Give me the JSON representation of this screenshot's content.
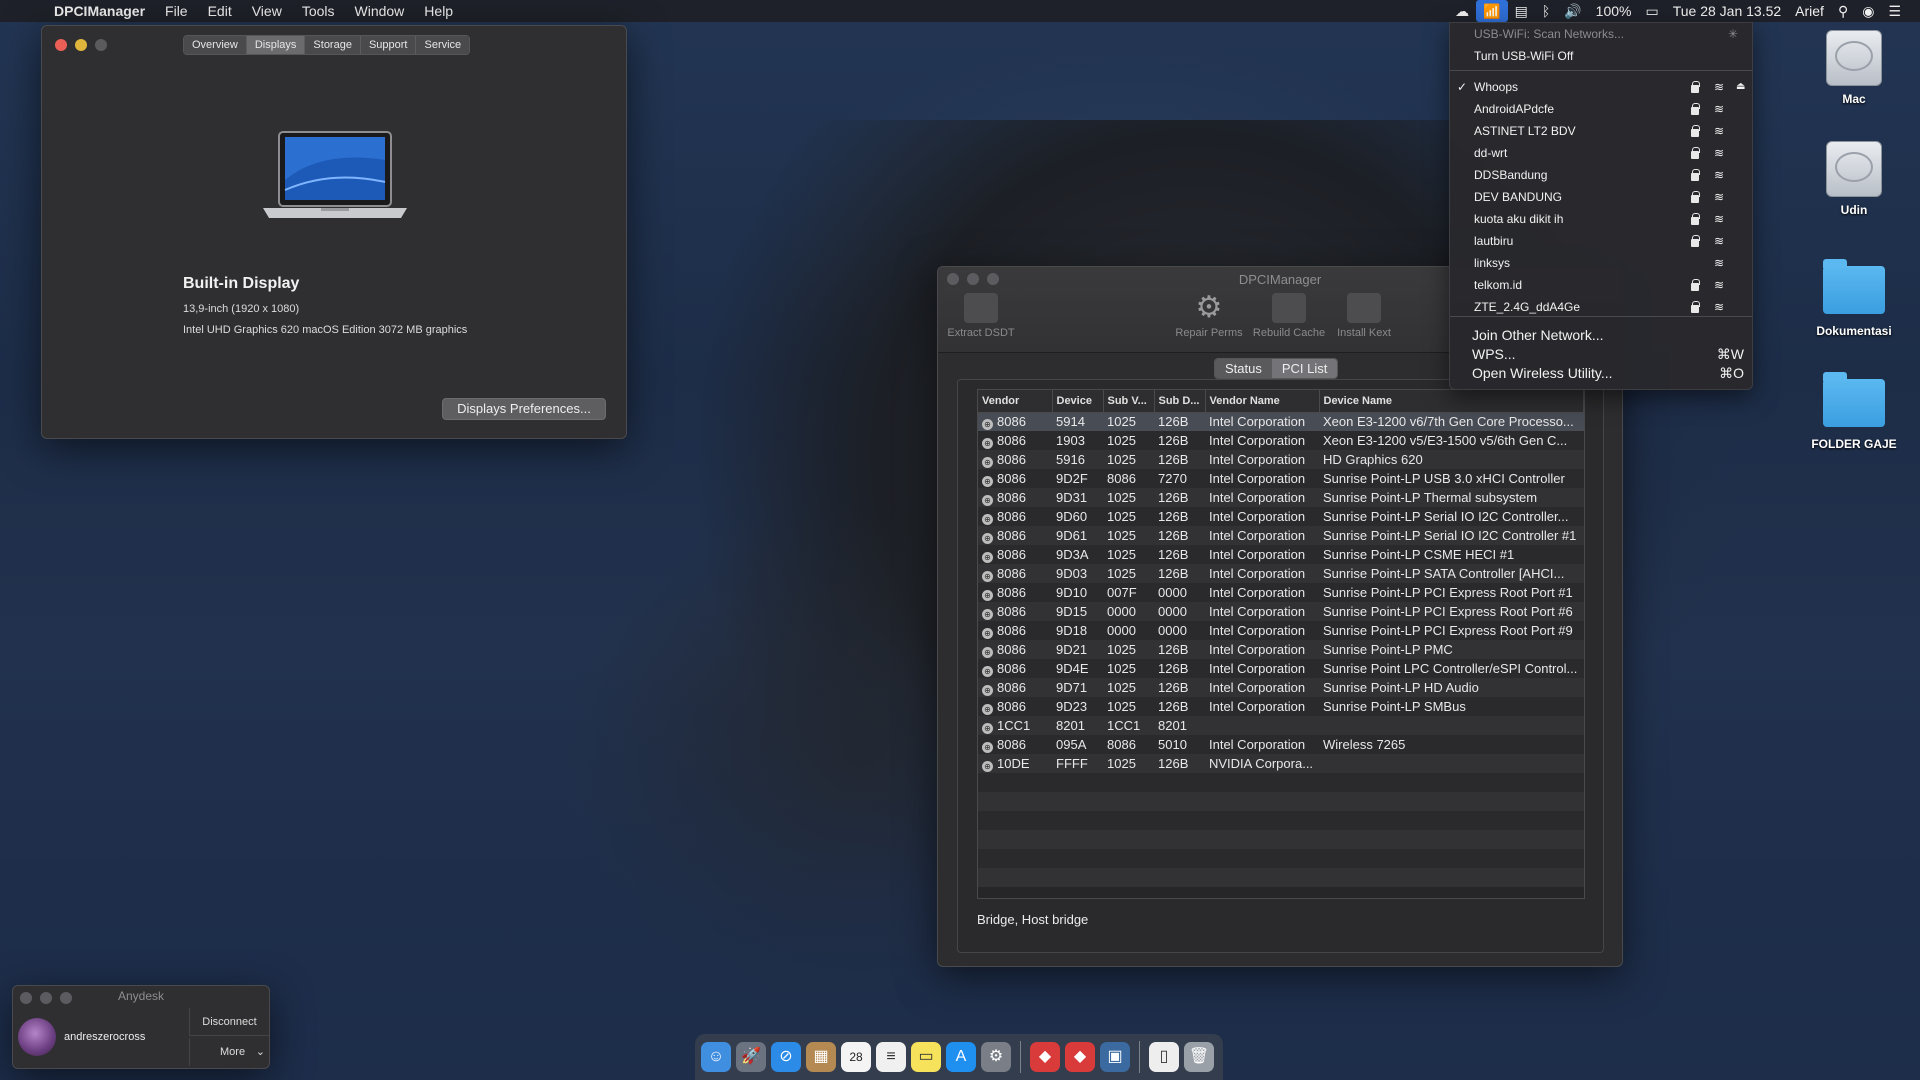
{
  "menubar": {
    "app_name": "DPCIManager",
    "menus": [
      "File",
      "Edit",
      "View",
      "Tools",
      "Window",
      "Help"
    ],
    "battery": "100%",
    "clock": "Tue 28 Jan  13.52",
    "user": "Arief"
  },
  "about_window": {
    "tabs": [
      "Overview",
      "Displays",
      "Storage",
      "Support",
      "Service"
    ],
    "selected_tab": "Displays",
    "title": "Built-in Display",
    "spec_size": "13,9-inch (1920 x 1080)",
    "spec_graphics": "Intel UHD Graphics 620 macOS Edition 3072 MB graphics",
    "prefs_button": "Displays Preferences..."
  },
  "dpci_window": {
    "title": "DPCIManager",
    "toolbar": {
      "extract": "Extract DSDT",
      "repair": "Repair Perms",
      "rebuild": "Rebuild Cache",
      "install": "Install Kext"
    },
    "segments": [
      "Status",
      "PCI List"
    ],
    "selected_segment": "PCI List",
    "columns": [
      "Vendor",
      "Device",
      "Sub V...",
      "Sub D...",
      "Vendor Name",
      "Device Name"
    ],
    "rows": [
      [
        "8086",
        "5914",
        "1025",
        "126B",
        "Intel Corporation",
        "Xeon E3-1200 v6/7th Gen Core Processo..."
      ],
      [
        "8086",
        "1903",
        "1025",
        "126B",
        "Intel Corporation",
        "Xeon E3-1200 v5/E3-1500 v5/6th Gen C..."
      ],
      [
        "8086",
        "5916",
        "1025",
        "126B",
        "Intel Corporation",
        "HD Graphics 620"
      ],
      [
        "8086",
        "9D2F",
        "8086",
        "7270",
        "Intel Corporation",
        "Sunrise Point-LP USB 3.0 xHCI Controller"
      ],
      [
        "8086",
        "9D31",
        "1025",
        "126B",
        "Intel Corporation",
        "Sunrise Point-LP Thermal subsystem"
      ],
      [
        "8086",
        "9D60",
        "1025",
        "126B",
        "Intel Corporation",
        "Sunrise Point-LP Serial IO I2C Controller..."
      ],
      [
        "8086",
        "9D61",
        "1025",
        "126B",
        "Intel Corporation",
        "Sunrise Point-LP Serial IO I2C Controller #1"
      ],
      [
        "8086",
        "9D3A",
        "1025",
        "126B",
        "Intel Corporation",
        "Sunrise Point-LP CSME HECI #1"
      ],
      [
        "8086",
        "9D03",
        "1025",
        "126B",
        "Intel Corporation",
        "Sunrise Point-LP SATA Controller [AHCI..."
      ],
      [
        "8086",
        "9D10",
        "007F",
        "0000",
        "Intel Corporation",
        "Sunrise Point-LP PCI Express Root Port #1"
      ],
      [
        "8086",
        "9D15",
        "0000",
        "0000",
        "Intel Corporation",
        "Sunrise Point-LP PCI Express Root Port #6"
      ],
      [
        "8086",
        "9D18",
        "0000",
        "0000",
        "Intel Corporation",
        "Sunrise Point-LP PCI Express Root Port #9"
      ],
      [
        "8086",
        "9D21",
        "1025",
        "126B",
        "Intel Corporation",
        "Sunrise Point-LP PMC"
      ],
      [
        "8086",
        "9D4E",
        "1025",
        "126B",
        "Intel Corporation",
        "Sunrise Point LPC Controller/eSPI Control..."
      ],
      [
        "8086",
        "9D71",
        "1025",
        "126B",
        "Intel Corporation",
        "Sunrise Point-LP HD Audio"
      ],
      [
        "8086",
        "9D23",
        "1025",
        "126B",
        "Intel Corporation",
        "Sunrise Point-LP SMBus"
      ],
      [
        "1CC1",
        "8201",
        "1CC1",
        "8201",
        "",
        ""
      ],
      [
        "8086",
        "095A",
        "8086",
        "5010",
        "Intel Corporation",
        "Wireless 7265"
      ],
      [
        "10DE",
        "FFFF",
        "1025",
        "126B",
        "NVIDIA Corpora...",
        ""
      ]
    ],
    "status_text": "Bridge, Host bridge"
  },
  "wifi_menu": {
    "scan": "USB-WiFi: Scan Networks...",
    "turn_off": "Turn USB-WiFi Off",
    "networks": [
      {
        "name": "Whoops",
        "checked": true,
        "locked": true
      },
      {
        "name": "AndroidAPdcfe",
        "checked": false,
        "locked": true
      },
      {
        "name": "ASTINET LT2 BDV",
        "checked": false,
        "locked": true
      },
      {
        "name": "dd-wrt",
        "checked": false,
        "locked": true
      },
      {
        "name": "DDSBandung",
        "checked": false,
        "locked": true
      },
      {
        "name": "DEV BANDUNG",
        "checked": false,
        "locked": true
      },
      {
        "name": "kuota aku dikit ih",
        "checked": false,
        "locked": true
      },
      {
        "name": "lautbiru",
        "checked": false,
        "locked": true
      },
      {
        "name": "linksys",
        "checked": false,
        "locked": false
      },
      {
        "name": "telkom.id",
        "checked": false,
        "locked": true
      },
      {
        "name": "ZTE_2.4G_ddA4Ge",
        "checked": false,
        "locked": true
      }
    ],
    "join_other": "Join Other Network...",
    "wps": "WPS...",
    "wps_shortcut": "⌘W",
    "open_utility": "Open Wireless Utility...",
    "open_utility_shortcut": "⌘O"
  },
  "desktop_icons": [
    "Mac",
    "Udin",
    "Dokumentasi",
    "FOLDER GAJE"
  ],
  "anydesk": {
    "title": "Anydesk",
    "user": "andreszerocross",
    "disconnect": "Disconnect",
    "more": "More"
  },
  "dock": {
    "calendar_day": "28"
  }
}
